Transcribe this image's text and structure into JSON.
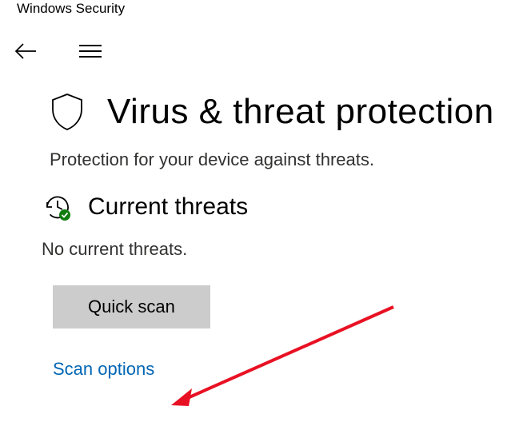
{
  "window": {
    "title": "Windows Security"
  },
  "page": {
    "title": "Virus & threat protection",
    "subtitle": "Protection for your device against threats."
  },
  "section": {
    "title": "Current threats",
    "status": "No current threats.",
    "quick_scan_label": "Quick scan",
    "scan_options_label": "Scan options"
  },
  "colors": {
    "link": "#0066b4",
    "button_bg": "#cccccc",
    "arrow": "#e81123"
  }
}
